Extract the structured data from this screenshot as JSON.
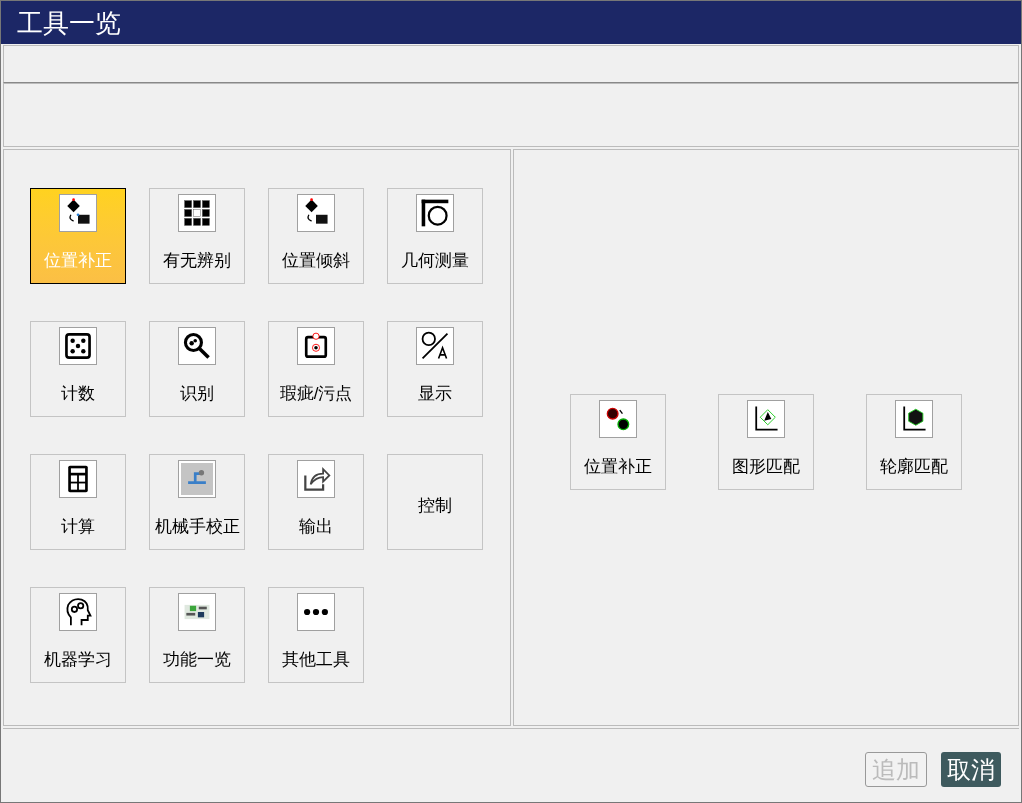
{
  "window": {
    "title": "工具一览"
  },
  "tools": [
    {
      "label": "位置补正",
      "kind": "icon",
      "selected": true
    },
    {
      "label": "有无辨别",
      "kind": "icon",
      "selected": false
    },
    {
      "label": "位置倾斜",
      "kind": "icon",
      "selected": false
    },
    {
      "label": "几何测量",
      "kind": "icon",
      "selected": false
    },
    {
      "label": "计数",
      "kind": "icon",
      "selected": false
    },
    {
      "label": "识别",
      "kind": "icon",
      "selected": false
    },
    {
      "label": "瑕疵/污点",
      "kind": "icon",
      "selected": false
    },
    {
      "label": "显示",
      "kind": "icon",
      "selected": false
    },
    {
      "label": "计算",
      "kind": "icon",
      "selected": false
    },
    {
      "label": "机械手校正",
      "kind": "icon",
      "selected": false
    },
    {
      "label": "输出",
      "kind": "icon",
      "selected": false
    },
    {
      "label": "控制",
      "kind": "plain",
      "selected": false
    },
    {
      "label": "机器学习",
      "kind": "icon",
      "selected": false
    },
    {
      "label": "功能一览",
      "kind": "icon",
      "selected": false
    },
    {
      "label": "其他工具",
      "kind": "icon",
      "selected": false
    }
  ],
  "sub_tools": [
    {
      "label": "位置补正"
    },
    {
      "label": "图形匹配"
    },
    {
      "label": "轮廓匹配"
    }
  ],
  "buttons": [
    {
      "label": "追加",
      "disabled": true
    },
    {
      "label": "取消",
      "disabled": false
    }
  ]
}
